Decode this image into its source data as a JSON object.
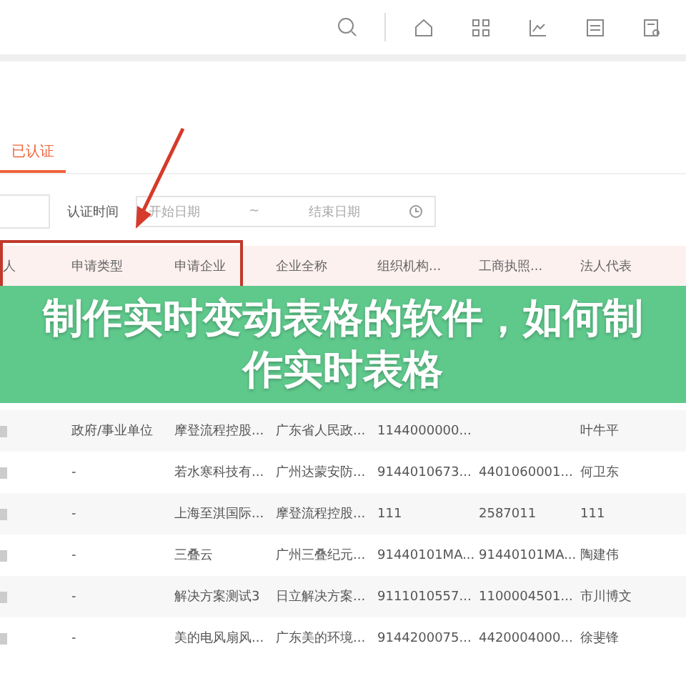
{
  "tabs": [
    {
      "label": "已认证",
      "selected": true
    }
  ],
  "filter": {
    "label": "认证时间",
    "start_placeholder": "开始日期",
    "separator": "~",
    "end_placeholder": "结束日期"
  },
  "table": {
    "columns": [
      "人",
      "申请类型",
      "申请企业",
      "企业全称",
      "组织机构...",
      "工商执照...",
      "法人代表"
    ],
    "rows": [
      [
        "",
        "政府/事业单位",
        "摩登流程控股...",
        "广东省人民政...",
        "1144000000...",
        "",
        "叶牛平"
      ],
      [
        "",
        "-",
        "若水寒科技有...",
        "广州达蒙安防...",
        "9144010673...",
        "4401060001...",
        "何卫东"
      ],
      [
        "",
        "-",
        "上海至淇国际...",
        "摩登流程控股...",
        "111",
        "2587011",
        "111"
      ],
      [
        "",
        "-",
        "三叠云",
        "广州三叠纪元...",
        "91440101MA...",
        "91440101MA...",
        "陶建伟"
      ],
      [
        "",
        "-",
        "解决方案测试3",
        "日立解决方案...",
        "9111010557...",
        "1100004501...",
        "市川博文"
      ],
      [
        "",
        "-",
        "美的电风扇风...",
        "广东美的环境...",
        "9144200075...",
        "4420004000...",
        "徐斐锋"
      ]
    ]
  },
  "banner": {
    "title": "制作实时变动表格的软件，如何制作实时表格"
  }
}
